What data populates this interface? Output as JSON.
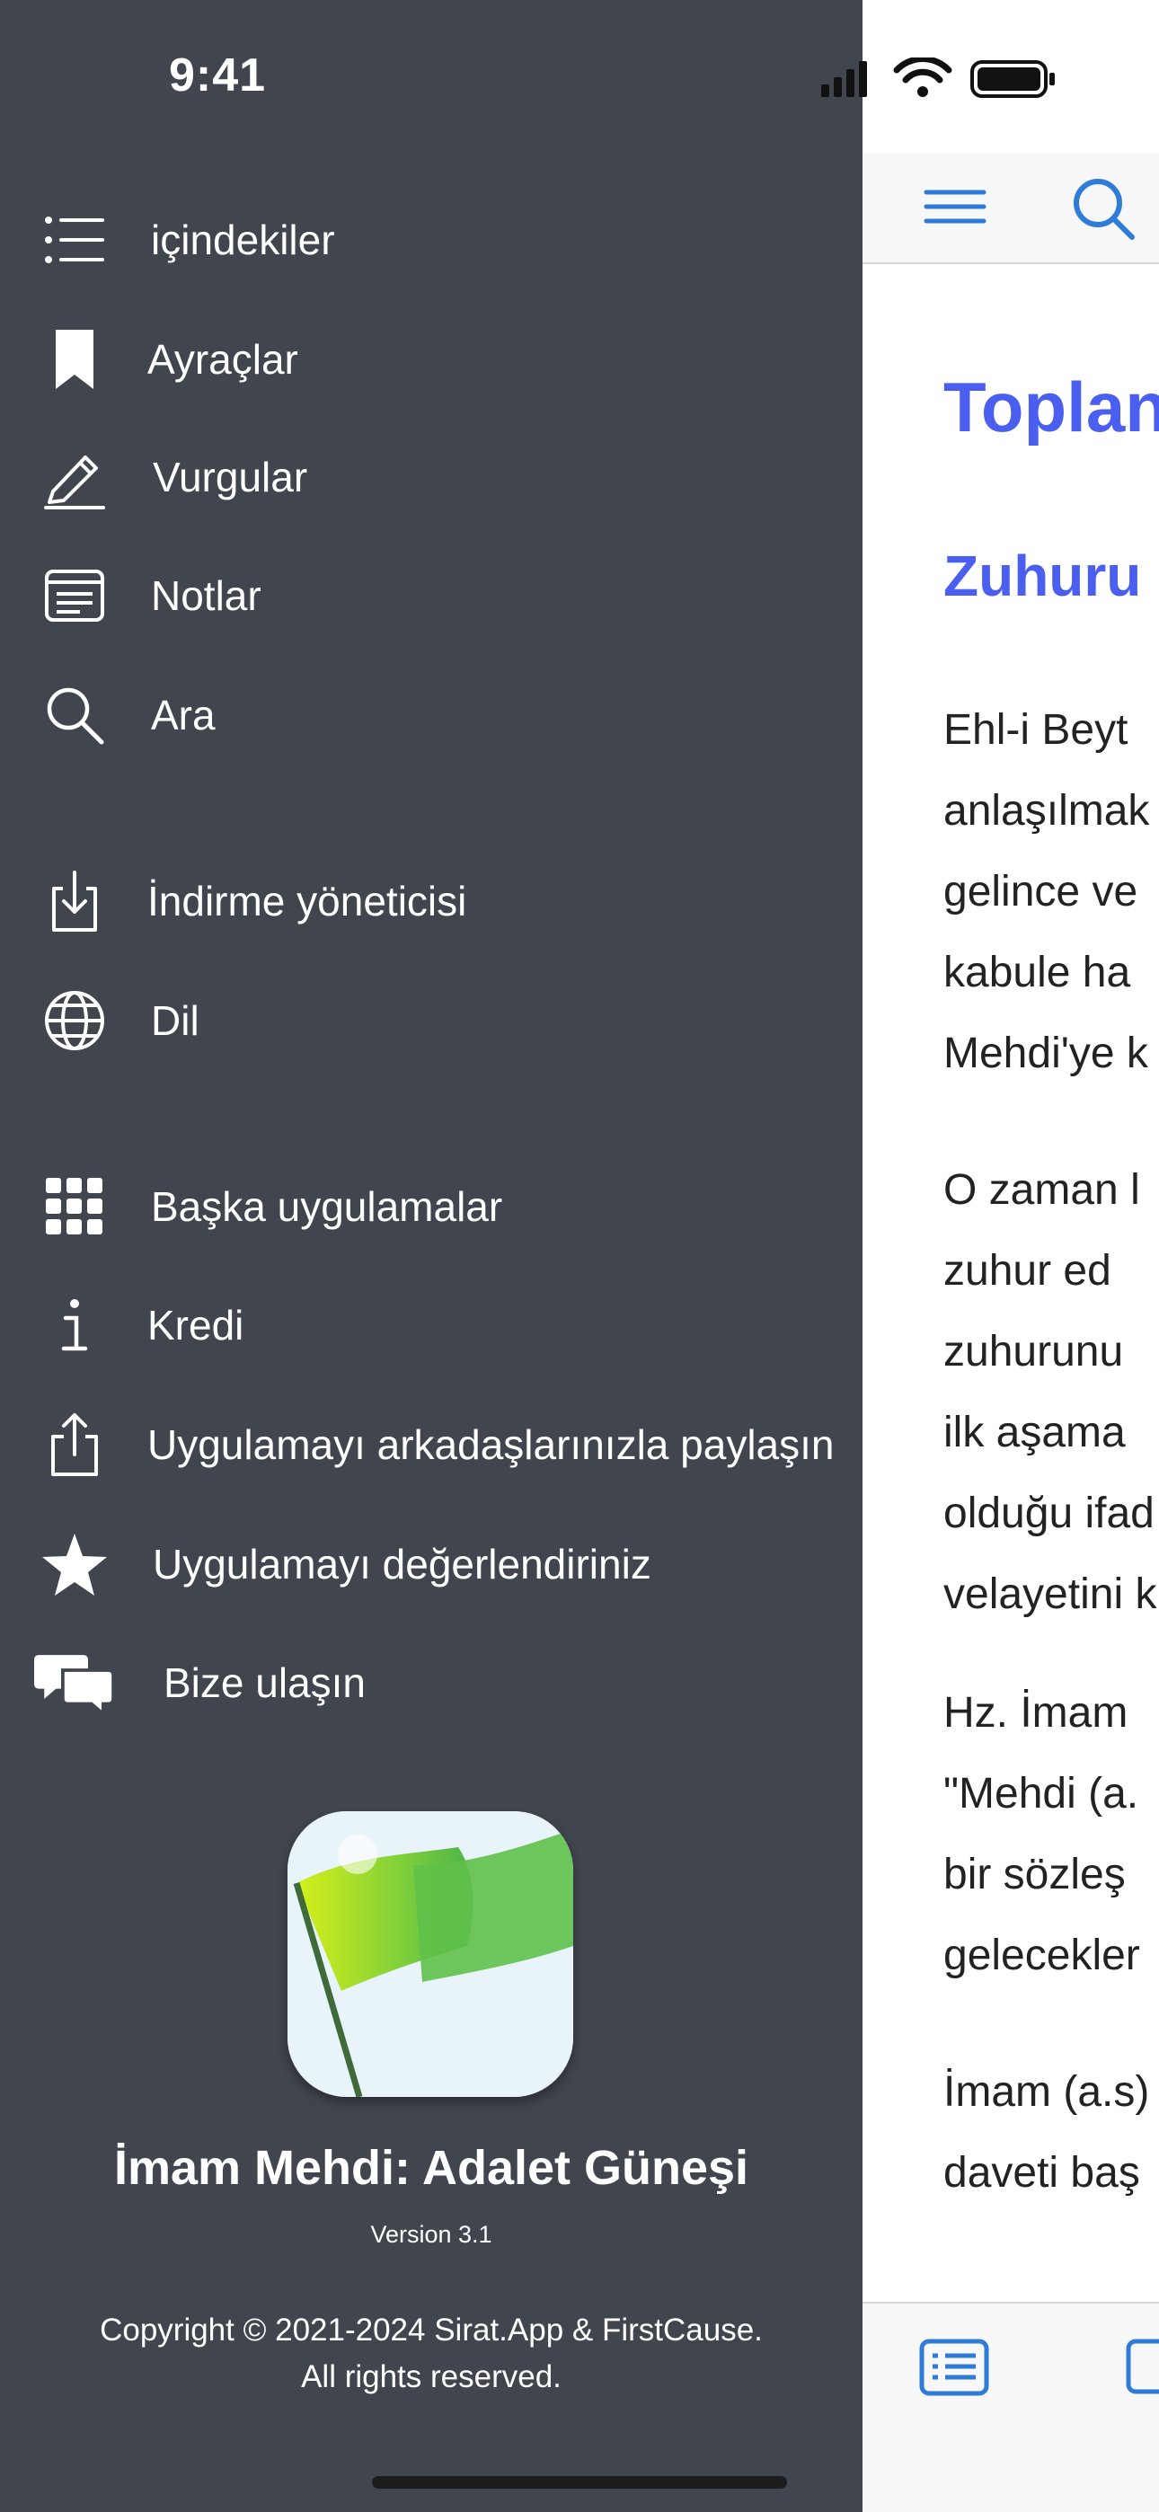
{
  "status_bar": {
    "time": "9:41"
  },
  "drawer": {
    "menu": [
      {
        "label": "içindekiler",
        "icon": "list-icon"
      },
      {
        "label": "Ayraçlar",
        "icon": "bookmark-icon"
      },
      {
        "label": "Vurgular",
        "icon": "pencil-icon"
      },
      {
        "label": "Notlar",
        "icon": "notes-icon"
      },
      {
        "label": "Ara",
        "icon": "search-icon"
      },
      {
        "label": "İndirme yöneticisi",
        "icon": "download-icon"
      },
      {
        "label": "Dil",
        "icon": "globe-icon"
      },
      {
        "label": "Başka uygulamalar",
        "icon": "apps-grid-icon"
      },
      {
        "label": "Kredi",
        "icon": "info-icon"
      },
      {
        "label": "Uygulamayı arkadaşlarınızla paylaşın",
        "icon": "share-icon"
      },
      {
        "label": "Uygulamayı değerlendiriniz",
        "icon": "star-icon"
      },
      {
        "label": "Bize ulaşın",
        "icon": "chat-bubbles-icon"
      }
    ],
    "app_name": "İmam Mehdi: Adalet Güneşi",
    "version": "Version 3.1",
    "copyright_line1": "Copyright © 2021-2024 Sirat.App & FirstCause.",
    "copyright_line2": "All rights reserved."
  },
  "content": {
    "title": "Toplan",
    "subtitle": "Zuhuru",
    "paragraphs": [
      [
        "Ehl-i Beyt",
        "anlaşılmak",
        "gelince  ve",
        "kabule  ha",
        "Mehdi'ye k"
      ],
      [
        "O zaman l",
        "zuhur  ed",
        "zuhurunu",
        "ilk  aşama",
        "olduğu ifad",
        "velayetini k"
      ],
      [
        "Hz.  İmam",
        "\"Mehdi (a.",
        "bir  sözleş",
        "gelecekler"
      ],
      [
        "İmam (a.s)",
        "daveti baş"
      ]
    ]
  },
  "colors": {
    "drawer_bg": "#41454d",
    "accent": "#4a5ef0",
    "icon_blue": "#2f7bd8"
  }
}
